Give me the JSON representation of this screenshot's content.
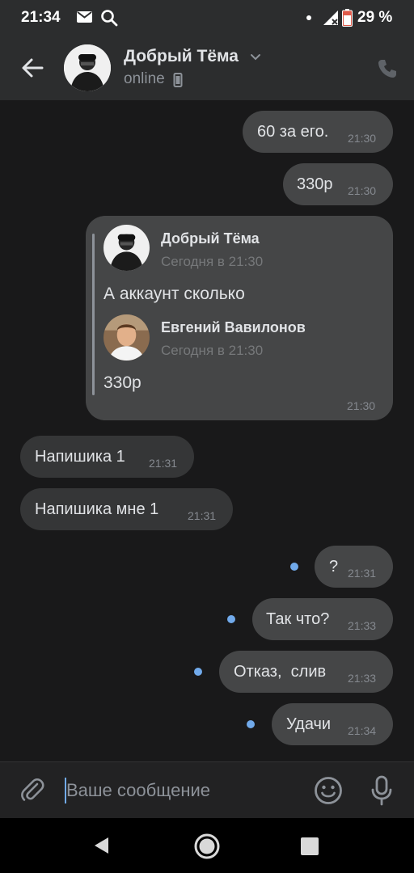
{
  "status_bar": {
    "time": "21:34",
    "battery": "29 %"
  },
  "header": {
    "name": "Добрый Тёма",
    "status": "online"
  },
  "messages": [
    {
      "text": "60 за его.",
      "time": "21:30"
    },
    {
      "text": "330р",
      "time": "21:30"
    },
    {
      "forwarded": [
        {
          "author": "Добрый Тёма",
          "date": "Сегодня в 21:30",
          "text": "А аккаунт сколько"
        },
        {
          "author": "Евгений Вавилонов",
          "date": "Сегодня в 21:30",
          "text": "330р"
        }
      ],
      "time": "21:30"
    },
    {
      "text": "Напишика 1",
      "time": "21:31"
    },
    {
      "text": "Напишика мне 1",
      "time": "21:31"
    },
    {
      "text": "?",
      "time": "21:31"
    },
    {
      "text": "Так что?",
      "time": "21:33"
    },
    {
      "text": "Отказ,  слив",
      "time": "21:33"
    },
    {
      "text": "Удачи",
      "time": "21:34"
    }
  ],
  "composer": {
    "placeholder": "Ваше сообщение"
  },
  "colors": {
    "accent": "#71aaeb",
    "bubble_out": "#454647",
    "bubble_in": "#353637",
    "background": "#19191a"
  },
  "icons": [
    "back-arrow",
    "chevron-down",
    "phone",
    "paperclip",
    "emoji",
    "microphone"
  ]
}
